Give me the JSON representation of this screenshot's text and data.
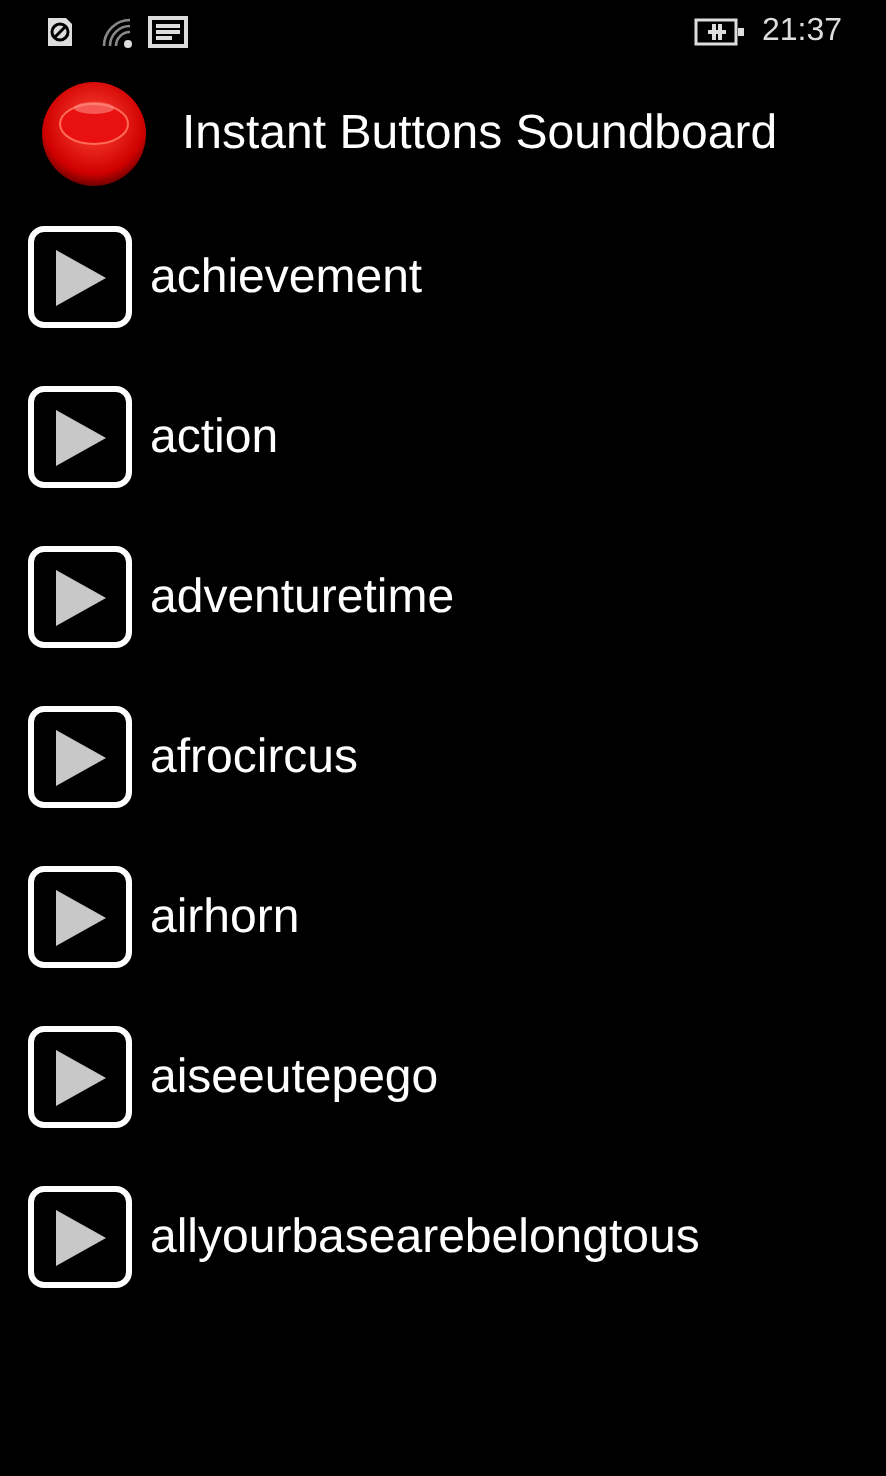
{
  "status_bar": {
    "time": "21:37"
  },
  "header": {
    "title": "Instant Buttons Soundboard"
  },
  "sounds": [
    {
      "name": "achievement"
    },
    {
      "name": "action"
    },
    {
      "name": "adventuretime"
    },
    {
      "name": "afrocircus"
    },
    {
      "name": "airhorn"
    },
    {
      "name": "aiseeutepego"
    },
    {
      "name": "allyourbasearebelongtous"
    }
  ]
}
